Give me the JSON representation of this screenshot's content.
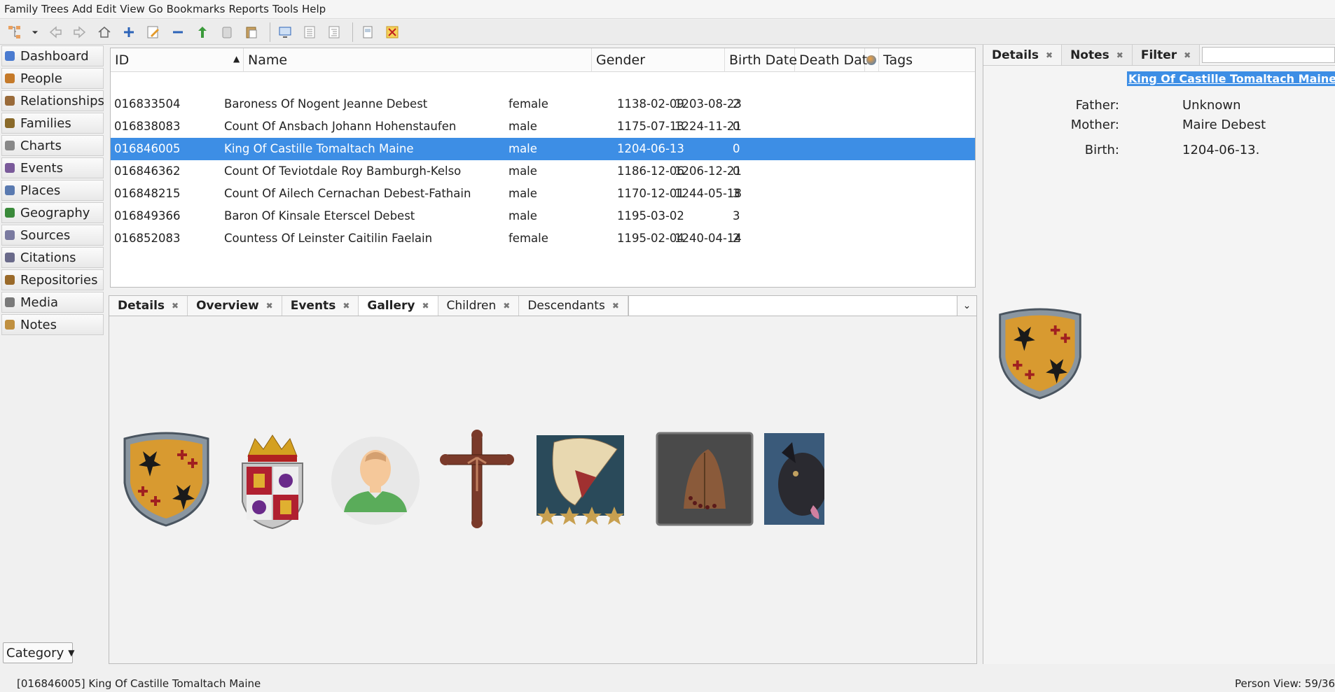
{
  "menu": [
    "Family Trees",
    "Add",
    "Edit",
    "View",
    "Go",
    "Bookmarks",
    "Reports",
    "Tools",
    "Help"
  ],
  "toolbar_icons": [
    "tree-icon",
    "dropdown-icon",
    "back-icon",
    "forward-icon",
    "home-icon",
    "add-icon",
    "edit-icon",
    "remove-icon",
    "merge-icon",
    "clipboard-icon",
    "paste-icon",
    "config-view-icon",
    "list-view-icon",
    "tree-view-icon",
    "report-icon",
    "tools-icon"
  ],
  "sidebar": {
    "items": [
      {
        "label": "Dashboard",
        "color": "#4a7bd0"
      },
      {
        "label": "People",
        "color": "#c57a2a"
      },
      {
        "label": "Relationships",
        "color": "#9a6b3a"
      },
      {
        "label": "Families",
        "color": "#8a6a2a"
      },
      {
        "label": "Charts",
        "color": "#888888"
      },
      {
        "label": "Events",
        "color": "#7a5a9a"
      },
      {
        "label": "Places",
        "color": "#5a7ab0"
      },
      {
        "label": "Geography",
        "color": "#3a8a3a"
      },
      {
        "label": "Sources",
        "color": "#7a7aa0"
      },
      {
        "label": "Citations",
        "color": "#6a6a8a"
      },
      {
        "label": "Repositories",
        "color": "#9a6a2a"
      },
      {
        "label": "Media",
        "color": "#7a7a7a"
      },
      {
        "label": "Notes",
        "color": "#c09040"
      }
    ],
    "category_label": "Category"
  },
  "table": {
    "headers": {
      "id": "ID",
      "name": "Name",
      "gender": "Gender",
      "birth": "Birth Date",
      "death": "Death Date",
      "tags": "Tags"
    },
    "rows": [
      {
        "id": "016833504",
        "name": "Baroness Of Nogent Jeanne Debest",
        "gender": "female",
        "birth": "1138-02-09",
        "death": "1203-08-23",
        "num": "2"
      },
      {
        "id": "016838083",
        "name": "Count Of Ansbach Johann Hohenstaufen",
        "gender": "male",
        "birth": "1175-07-13",
        "death": "1224-11-21",
        "num": "0"
      },
      {
        "id": "016846005",
        "name": "King Of Castille Tomaltach Maine",
        "gender": "male",
        "birth": "1204-06-13",
        "death": "",
        "num": "0"
      },
      {
        "id": "016846362",
        "name": "Count Of Teviotdale Roy Bamburgh-Kelso",
        "gender": "male",
        "birth": "1186-12-06",
        "death": "1206-12-21",
        "num": "0"
      },
      {
        "id": "016848215",
        "name": "Count Of Ailech Cernachan Debest-Fathain",
        "gender": "male",
        "birth": "1170-12-01",
        "death": "1244-05-18",
        "num": "3"
      },
      {
        "id": "016849366",
        "name": "Baron Of Kinsale Eterscel Debest",
        "gender": "male",
        "birth": "1195-03-02",
        "death": "",
        "num": "3"
      },
      {
        "id": "016852083",
        "name": "Countess Of Leinster Caitilin Faelain",
        "gender": "female",
        "birth": "1195-02-04",
        "death": "1240-04-14",
        "num": "2"
      }
    ]
  },
  "bottombar": {
    "tabs": [
      "Details",
      "Overview",
      "Events",
      "Gallery",
      "Children",
      "Descendants"
    ]
  },
  "gallery": {
    "items": [
      "coat-of-arms-image",
      "royal-crest-image",
      "person-silhouette-image",
      "crucifix-image",
      "scroll-stars-image",
      "praying-hands-image",
      "dog-image"
    ]
  },
  "right_panel": {
    "tabs": [
      "Details",
      "Notes",
      "Filter"
    ],
    "name": "King Of Castille Tomaltach Maine",
    "father_label": "Father:",
    "father": "Unknown",
    "mother_label": "Mother:",
    "mother": "Maire Debest",
    "birth_label": "Birth:",
    "birth": "1204-06-13."
  },
  "status": {
    "left": "[016846005] King Of Castille Tomaltach Maine",
    "right": "Person View: 59/36"
  }
}
